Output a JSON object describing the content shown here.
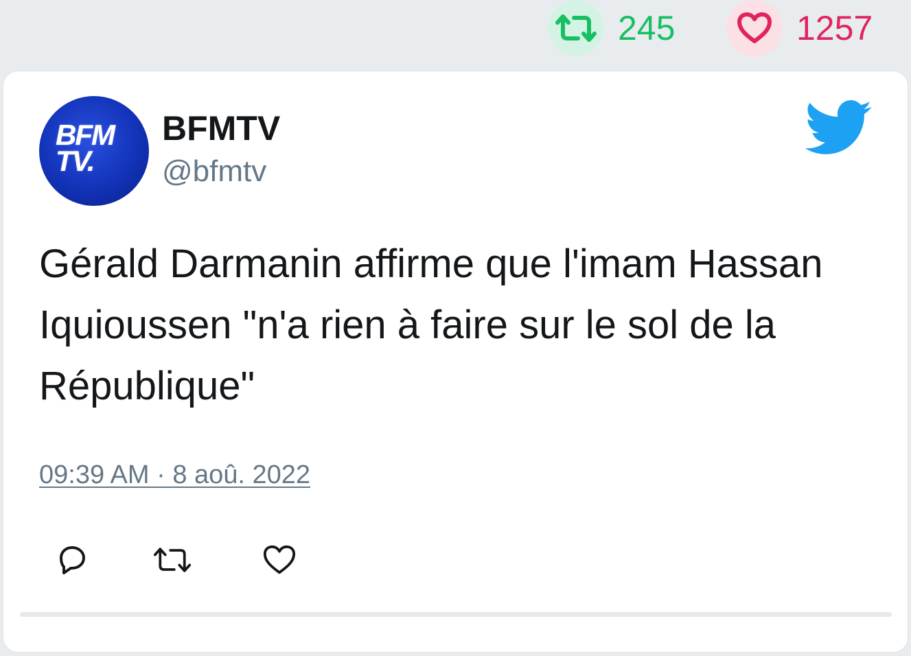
{
  "stats": {
    "retweets": "245",
    "likes": "1257",
    "retweet_icon": "retweet-icon",
    "like_icon": "heart-icon",
    "retweet_color": "#17bf63",
    "like_color": "#e0245e"
  },
  "tweet": {
    "avatar_text": "BFM\nTV.",
    "author_name": "BFMTV",
    "author_handle": "@bfmtv",
    "text": "Gérald Darmanin affirme que l'imam Hassan Iquioussen \"n'a rien à faire sur le sol de la République\"",
    "date": "09:39 AM · 8 aoû. 2022",
    "brand_icon": "twitter-bird-icon",
    "brand_color": "#1da1f2"
  },
  "actions": {
    "reply_icon": "reply-icon",
    "retweet_icon": "retweet-icon",
    "like_icon": "heart-icon"
  }
}
